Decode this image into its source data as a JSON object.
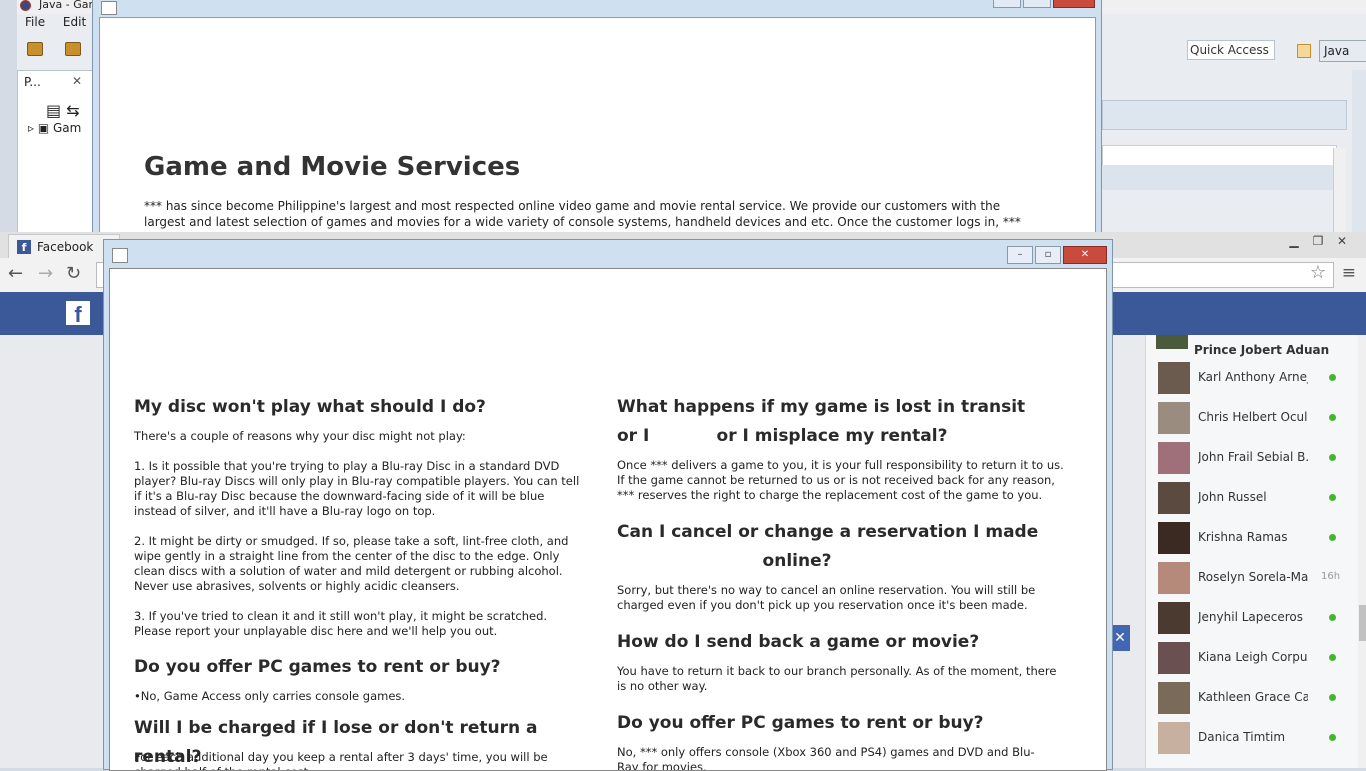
{
  "eclipse": {
    "title": "Java - Gar",
    "menu": [
      "File",
      "Edit"
    ],
    "quick_access": "Quick Access",
    "perspective": "Java",
    "package_tab": "P...",
    "tree_item": "Gam"
  },
  "java1": {
    "heading": "Game and Movie Services",
    "paragraph": " ***  has since become Philippine's largest and most respected online video game and movie rental service. We provide our customers with the largest and latest selection of games and movies for a wide variety of console systems, handheld devices and etc. Once the customer logs in, *** customers can"
  },
  "browser": {
    "tab_title": "Facebook",
    "chat": {
      "first": "Prince Jobert Aduan",
      "contacts": [
        {
          "name": "Karl Anthony Arnejo",
          "status": "online"
        },
        {
          "name": "Chris Helbert Oculam",
          "status": "online"
        },
        {
          "name": "John Frail Sebial B...",
          "status": "online"
        },
        {
          "name": "John Russel",
          "status": "online"
        },
        {
          "name": "Krishna Ramas",
          "status": "online"
        },
        {
          "name": "Roselyn Sorela-Ma...",
          "status": "16h"
        },
        {
          "name": "Jenyhil Lapeceros",
          "status": "online"
        },
        {
          "name": "Kiana Leigh Corpuz",
          "status": "online"
        },
        {
          "name": "Kathleen Grace Cal...",
          "status": "online"
        },
        {
          "name": "Danica Timtim",
          "status": "online"
        }
      ]
    }
  },
  "faq": {
    "left": [
      {
        "q": "My disc won't play what should I do?",
        "a": "There's a couple of reasons why your disc might not play:\n\n1. Is it possible that you're trying to play a Blu-ray Disc in a standard DVD player? Blu-ray Discs will only play in Blu-ray compatible players.  You can tell if it's a Blu-ray Disc because the downward-facing side of it will be blue instead of silver, and it'll have a Blu-ray logo on top.\n\n2. It might be dirty or smudged.  If so, please take a soft, lint-free cloth, and wipe gently in a straight line from the center of the disc to the edge. Only clean discs with a solution of water and mild detergent or rubbing alcohol.  Never use abrasives, solvents or highly acidic cleansers.\n\n3. If you've tried to clean it and it still won't play, it might be scratched.  Please report your unplayable disc here and we'll help you out."
      },
      {
        "q": "Do you offer PC games to rent or buy?",
        "a": "•No, Game Access only carries console games."
      },
      {
        "q": "Will I be charged if I lose or don't return a rental?",
        "a": "For each additional day you keep a rental after 3 days' time, you will be charged half of the rental cost ..."
      }
    ],
    "right": [
      {
        "q1": "What happens if my game is lost in transit or I",
        "q2": "or I misplace my rental?",
        "a": "Once *** delivers a game to you, it is your full responsibility to return it to us. If the game cannot be returned to us or is not received back for any reason, *** reserves the right to charge the replacement cost of the game to you."
      },
      {
        "q1": "Can I cancel or change a reservation I made",
        "q2": "online?",
        "a": "Sorry, but there's no way to cancel an online reservation. You will still be charged even if you don't pick up you reservation once it's been made."
      },
      {
        "q1": "How do I send back a game or movie?",
        "a": "You have to return it back to our branch personally. As of the moment, there is no other way."
      },
      {
        "q1": "Do you offer PC games to rent or buy?",
        "a": "No, *** only offers console (Xbox 360 and PS4) games and DVD and Blu-Ray for movies."
      }
    ]
  }
}
